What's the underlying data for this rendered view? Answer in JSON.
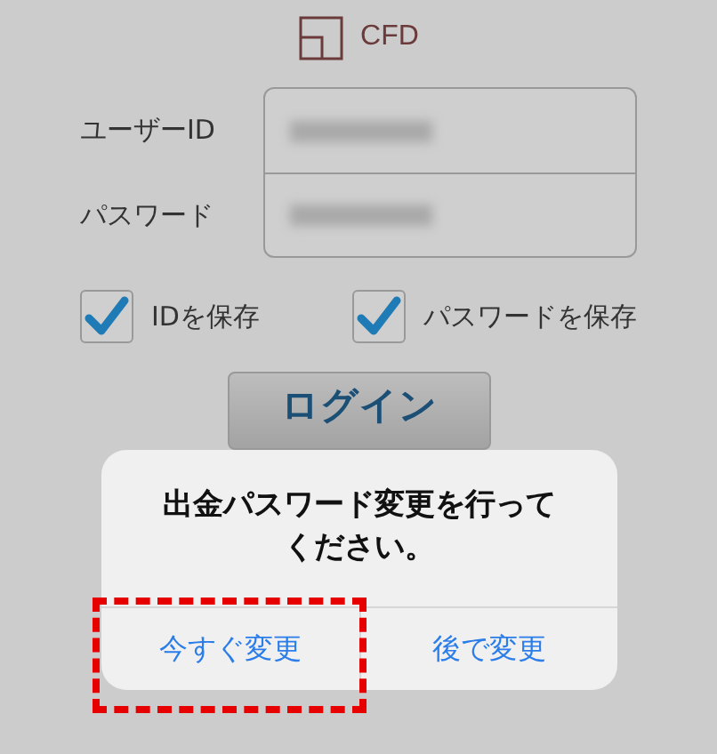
{
  "logo": {
    "text": "CFD"
  },
  "fields": [
    {
      "label": "ユーザーID",
      "masked": true
    },
    {
      "label": "パスワード",
      "masked": true
    }
  ],
  "checkboxes": [
    {
      "label": "IDを保存",
      "checked": true
    },
    {
      "label": "パスワードを保存",
      "checked": true
    }
  ],
  "login_button": {
    "label": "ログイン"
  },
  "dialog": {
    "message": "出金パスワード変更を行ってください。",
    "buttons": [
      {
        "label": "今すぐ変更",
        "highlighted": true
      },
      {
        "label": "後で変更",
        "highlighted": false
      }
    ]
  }
}
